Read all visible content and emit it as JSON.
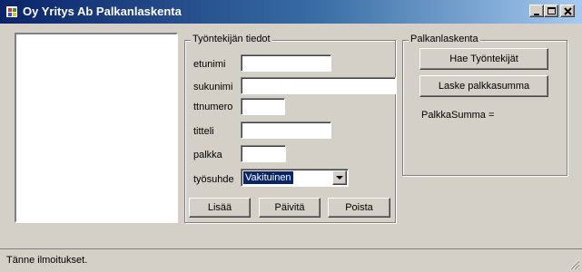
{
  "window": {
    "title": "Oy Yritys Ab Palkanlaskenta",
    "title_gradient": [
      "#0a246a",
      "#a6caf0"
    ]
  },
  "employee_group": {
    "legend": "Työntekijän tiedot",
    "fields": {
      "etunimi": {
        "label": "etunimi",
        "value": ""
      },
      "sukunimi": {
        "label": "sukunimi",
        "value": ""
      },
      "ttnumero": {
        "label": "ttnumero",
        "value": ""
      },
      "titteli": {
        "label": "titteli",
        "value": ""
      },
      "palkka": {
        "label": "palkka",
        "value": ""
      },
      "tyosuhde": {
        "label": "työsuhde",
        "value": "Vakituinen"
      }
    },
    "buttons": {
      "add": "Lisää",
      "update": "Päivitä",
      "delete": "Poista"
    }
  },
  "payroll_group": {
    "legend": "Palkanlaskenta",
    "fetch_button": "Hae Työntekijät",
    "sum_button": "Laske palkkasumma",
    "sum_label": "PalkkaSumma ="
  },
  "status": {
    "text": "Tänne ilmoitukset."
  }
}
